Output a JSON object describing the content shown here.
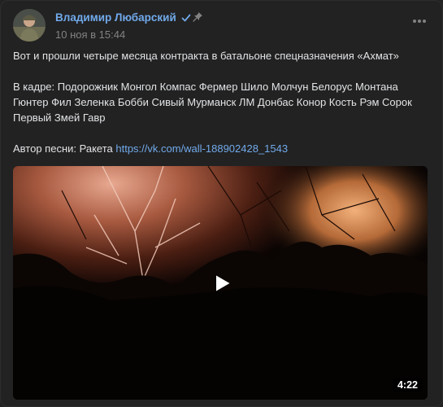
{
  "post": {
    "author_name": "Владимир Любарский",
    "date": "10 ноя в 15:44",
    "line1": "Вот и прошли четыре месяца контракта в батальоне спецназначения «Ахмат»",
    "line2": "В кадре: Подорожник Монгол Компас Фермер Шило Молчун Белорус Монтана Гюнтер Фил Зеленка Бобби Сивый Мурманск ЛМ Донбас Конор Кость Рэм Сорок Первый Змей Гавр",
    "song_label": "Автор песни: Ракета ",
    "song_link": "https://vk.com/wall-188902428_1543"
  },
  "video": {
    "duration": "4:22"
  },
  "icons": {
    "verified": "verified-check-icon",
    "pin": "pin-icon",
    "more": "more-dots-icon",
    "play": "play-icon"
  },
  "colors": {
    "background": "#222222",
    "link": "#71aaeb",
    "muted": "#828282",
    "text": "#e1e3e6"
  }
}
